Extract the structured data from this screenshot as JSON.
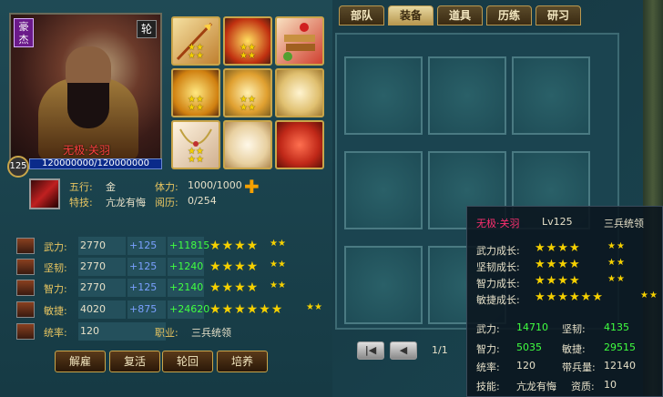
{
  "hero": {
    "rank_badge": "豪杰",
    "round_badge": "轮",
    "name": "无极·关羽",
    "level": "125",
    "hp": "120000000/120000000",
    "element_label": "五行:",
    "element": "金",
    "special_label": "特技:",
    "special": "亢龙有悔",
    "stamina_label": "体力:",
    "stamina": "1000/1000",
    "exp_label": "阅历:",
    "exp": "0/254",
    "colors": {
      "name": "#ff4040",
      "hp_bar": "#0a2a8a"
    }
  },
  "equipment_slots": [
    {
      "icon": "spear-icon",
      "stars": "★★\n★★"
    },
    {
      "icon": "flame-armor-icon",
      "stars": "★★\n★★"
    },
    {
      "icon": "scroll-bundle-icon",
      "stars": ""
    },
    {
      "icon": "gold-treasure-icon",
      "stars": "★★\n★★"
    },
    {
      "icon": "golden-phoenix-icon",
      "stars": "★★\n★★"
    },
    {
      "icon": "golden-idol-icon",
      "stars": ""
    },
    {
      "icon": "necklace-icon",
      "stars": "★★\n★★"
    },
    {
      "icon": "white-dragon-icon",
      "stars": ""
    },
    {
      "icon": "red-banner-icon",
      "stars": ""
    }
  ],
  "attributes": [
    {
      "name": "武力:",
      "base": "2770",
      "add": "+125",
      "grow": "+11815",
      "stars": "★★★★",
      "small": "★★"
    },
    {
      "name": "坚韧:",
      "base": "2770",
      "add": "+125",
      "grow": "+1240",
      "stars": "★★★★",
      "small": "★★"
    },
    {
      "name": "智力:",
      "base": "2770",
      "add": "+125",
      "grow": "+2140",
      "stars": "★★★★",
      "small": "★★"
    },
    {
      "name": "敏捷:",
      "base": "4020",
      "add": "+875",
      "grow": "+24620",
      "stars": "★★★★★★",
      "small": "★★"
    }
  ],
  "command": {
    "label": "统率:",
    "value": "120",
    "job_label": "职业:",
    "job": "三兵统领"
  },
  "buttons": {
    "dismiss": "解雇",
    "revive": "复活",
    "cycle": "轮回",
    "train": "培养"
  },
  "tabs": [
    "部队",
    "装备",
    "道具",
    "历练",
    "研习"
  ],
  "active_tab": 1,
  "pager": {
    "first": "|◀",
    "prev": "◀",
    "text": "1/1"
  },
  "tooltip": {
    "name": "无极·关羽",
    "level": "Lv125",
    "job": "三兵统领",
    "growth": [
      {
        "label": "武力成长:",
        "stars": "★★★★",
        "small": "★★"
      },
      {
        "label": "坚韧成长:",
        "stars": "★★★★",
        "small": "★★"
      },
      {
        "label": "智力成长:",
        "stars": "★★★★",
        "small": "★★"
      },
      {
        "label": "敏捷成长:",
        "stars": "★★★★★★",
        "small": "★★"
      }
    ],
    "wuli_label": "武力:",
    "wuli": "14710",
    "jianren_label": "坚韧:",
    "jianren": "4135",
    "zhili_label": "智力:",
    "zhili": "5035",
    "minjie_label": "敏捷:",
    "minjie": "29515",
    "tonglv_label": "统率:",
    "tonglv": "120",
    "daibing_label": "带兵量:",
    "daibing": "12140",
    "skill_label": "技能:",
    "skill": "亢龙有悔",
    "aptitude_label": "资质:",
    "aptitude": "10"
  }
}
